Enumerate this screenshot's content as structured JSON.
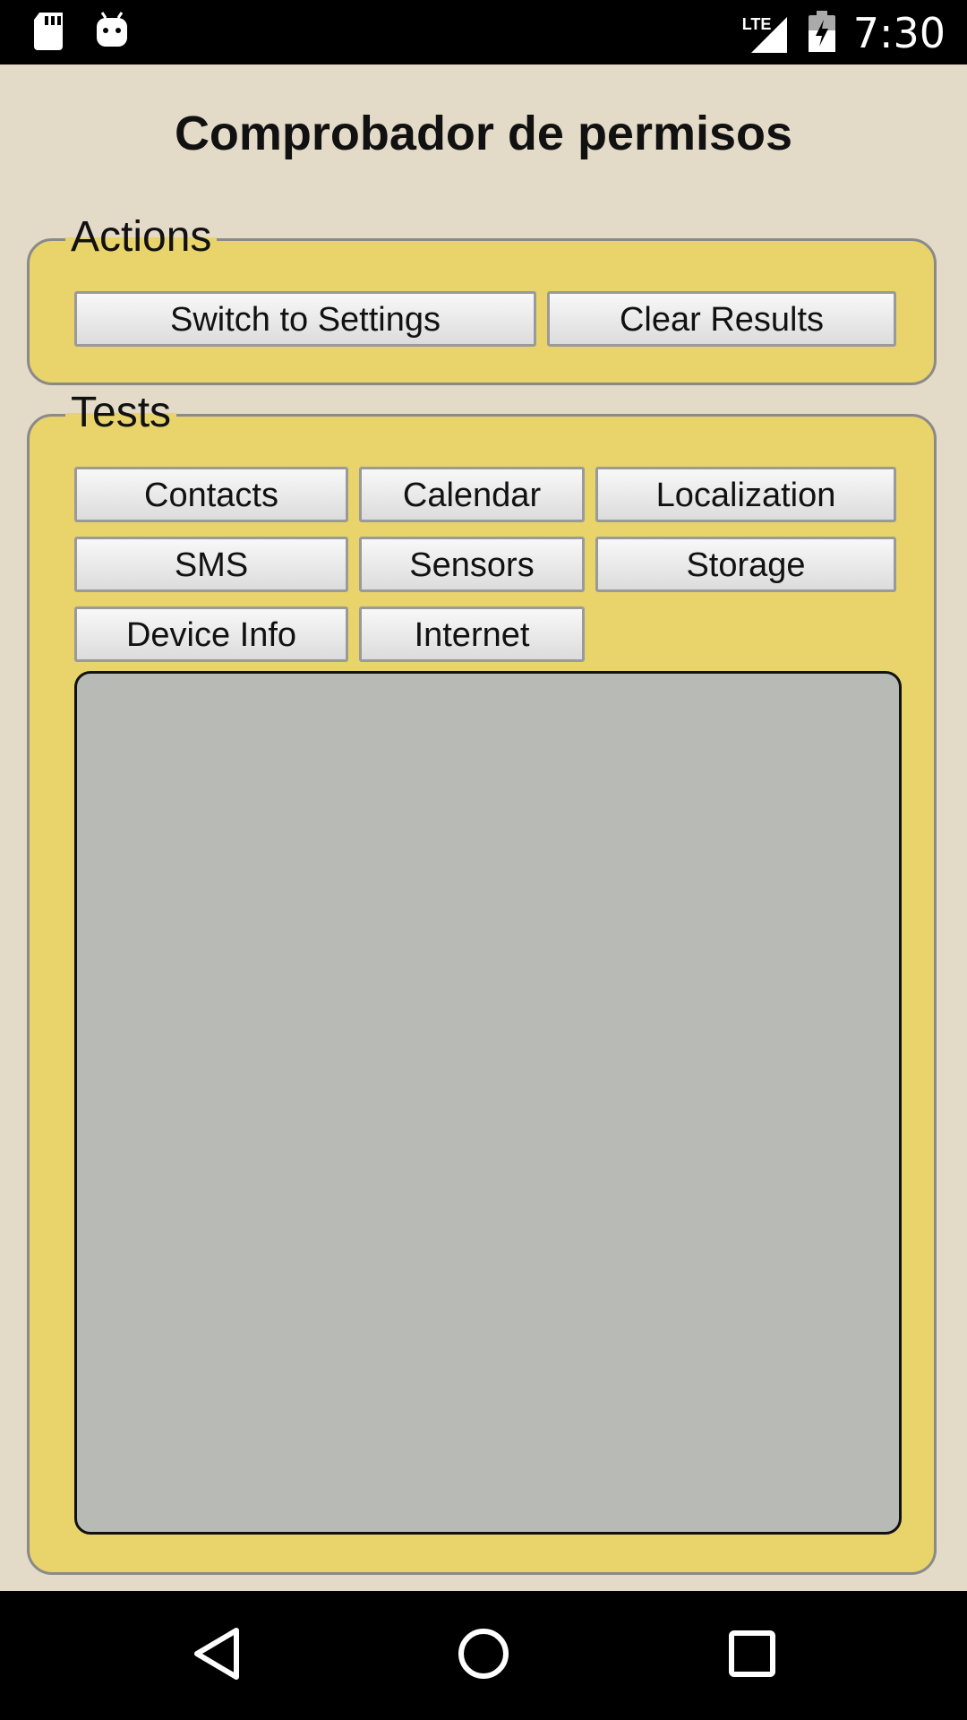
{
  "status_bar": {
    "time": "7:30",
    "network_label": "LTE",
    "icons": [
      "sd-card-icon",
      "android-debug-icon",
      "signal-icon",
      "battery-charging-icon"
    ]
  },
  "app": {
    "title": "Comprobador de permisos"
  },
  "actions": {
    "legend": "Actions",
    "switch_label": "Switch to Settings",
    "clear_label": "Clear Results"
  },
  "tests": {
    "legend": "Tests",
    "buttons": [
      "Contacts",
      "Calendar",
      "Localization",
      "SMS",
      "Sensors",
      "Storage",
      "Device Info",
      "Internet"
    ],
    "results_text": ""
  },
  "nav_bar": {
    "icons": [
      "back-icon",
      "home-icon",
      "recents-icon"
    ]
  },
  "colors": {
    "background": "#e3dac8",
    "group_fill": "#e8d46b",
    "results_fill": "#b8bbb5"
  }
}
